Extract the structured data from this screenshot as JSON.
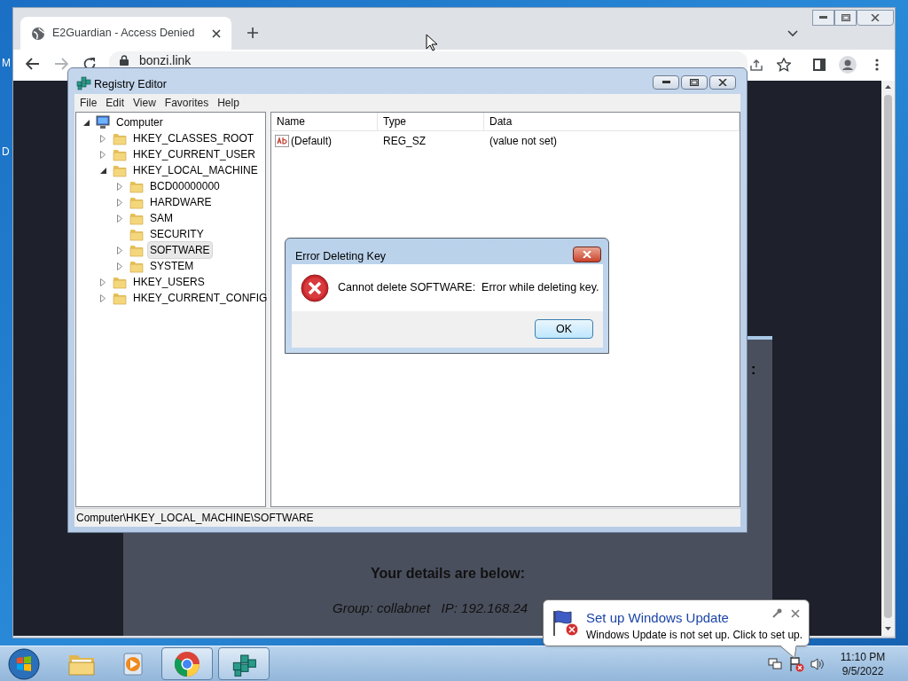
{
  "desktop": {
    "icon_labels": [
      "M",
      "D"
    ]
  },
  "browser": {
    "tabs": [
      {
        "title": "E2Guardian - Access Denied",
        "selected": true
      }
    ],
    "address": "bonzi.link",
    "page": {
      "fragment": ":",
      "heading": "Your details are below:",
      "details": "Group: collabnet   IP: 192.168.24"
    }
  },
  "registry_editor": {
    "title": "Registry Editor",
    "menu": [
      "File",
      "Edit",
      "View",
      "Favorites",
      "Help"
    ],
    "tree": [
      {
        "label": "Computer",
        "expanded": true,
        "selected": false,
        "children": [
          {
            "label": "HKEY_CLASSES_ROOT",
            "expanded": false,
            "selected": false
          },
          {
            "label": "HKEY_CURRENT_USER",
            "expanded": false,
            "selected": false
          },
          {
            "label": "HKEY_LOCAL_MACHINE",
            "expanded": true,
            "selected": false,
            "children": [
              {
                "label": "BCD00000000",
                "expanded": false,
                "selected": false
              },
              {
                "label": "HARDWARE",
                "expanded": false,
                "selected": false
              },
              {
                "label": "SAM",
                "expanded": false,
                "selected": false
              },
              {
                "label": "SECURITY",
                "selected": false
              },
              {
                "label": "SOFTWARE",
                "expanded": false,
                "selected": true
              },
              {
                "label": "SYSTEM",
                "expanded": false,
                "selected": false
              }
            ]
          },
          {
            "label": "HKEY_USERS",
            "expanded": false,
            "selected": false
          },
          {
            "label": "HKEY_CURRENT_CONFIG",
            "expanded": false,
            "selected": false
          }
        ]
      }
    ],
    "columns": [
      "Name",
      "Type",
      "Data"
    ],
    "rows": [
      {
        "name": "(Default)",
        "type": "REG_SZ",
        "data": "(value not set)"
      }
    ],
    "status_bar": "Computer\\HKEY_LOCAL_MACHINE\\SOFTWARE"
  },
  "dialog": {
    "title": "Error Deleting Key",
    "message": "Cannot delete SOFTWARE:  Error while deleting key.",
    "button": "OK"
  },
  "notification": {
    "title": "Set up Windows Update",
    "message": "Windows Update is not set up. Click to set up."
  },
  "taskbar": {
    "apps": [
      {
        "kind": "explorer",
        "running": false
      },
      {
        "kind": "media",
        "running": false
      },
      {
        "kind": "chrome",
        "running": true
      },
      {
        "kind": "regedit",
        "running": true
      }
    ],
    "clock": {
      "time": "11:10 PM",
      "date": "9/5/2022"
    }
  }
}
